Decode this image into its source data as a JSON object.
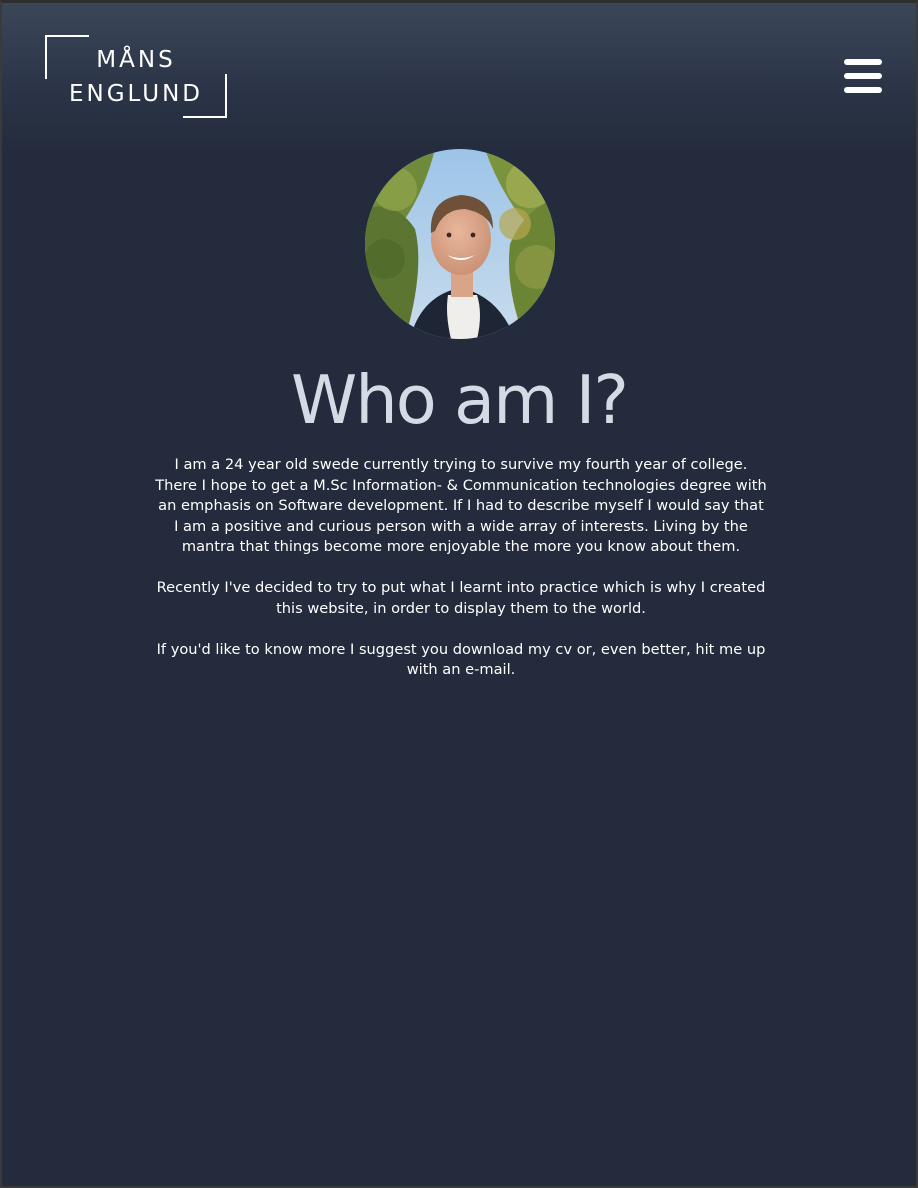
{
  "header": {
    "logo_line1": "MÅNS",
    "logo_line2": "ENGLUND"
  },
  "menu": {
    "icon": "hamburger-menu-icon"
  },
  "profile": {
    "photo_alt": "Portrait photo"
  },
  "main": {
    "title": "Who am I?",
    "paragraphs": [
      "I am a 24 year old swede currently trying to survive my fourth year of college. There I hope to get a M.Sc Information- & Communication technologies degree with an emphasis on Software development. If I had  to describe myself I would say that I am a positive and curious person with a wide array of interests. Living by the mantra that things become more enjoyable the more you know about them.",
      "Recently I've decided to try to put what I learnt into practice which is why I created this website, in order to display them to the world.",
      "If you'd like to know more I suggest you download my cv or, even better, hit me up with an e-mail."
    ]
  },
  "colors": {
    "background": "#232b3c",
    "title": "#d4dbe4",
    "text": "#ffffff"
  }
}
